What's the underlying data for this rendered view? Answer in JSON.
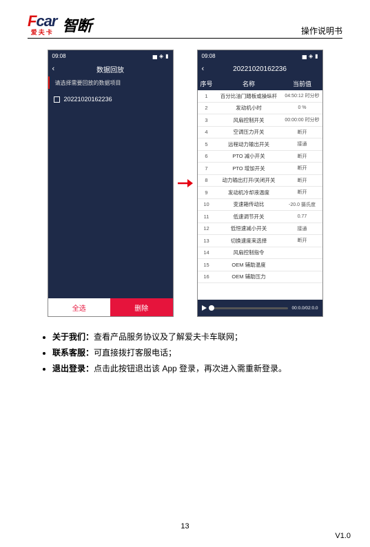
{
  "header": {
    "fcar_f": "F",
    "fcar_car": "car",
    "fcar_sub": "爱夫卡",
    "zd": "智断",
    "doc_title": "操作说明书"
  },
  "left_phone": {
    "time": "09:08",
    "title": "数据回放",
    "subtitle": "请选择需要回放的数据项目",
    "item1": "20221020162236",
    "btn_all": "全选",
    "btn_del": "删除"
  },
  "right_phone": {
    "time": "09:08",
    "title": "20221020162236",
    "head_idx": "序号",
    "head_name": "名称",
    "head_val": "当前值",
    "rows": [
      {
        "i": "1",
        "n": "百分比油门踏板或操纵杆",
        "v": "04:50:12 时分秒"
      },
      {
        "i": "2",
        "n": "发动机小时",
        "v": "0 %"
      },
      {
        "i": "3",
        "n": "风扇控制开关",
        "v": "00:00:00 时分秒"
      },
      {
        "i": "4",
        "n": "空调压力开关",
        "v": "断开"
      },
      {
        "i": "5",
        "n": "远程动力输出开关",
        "v": "接通"
      },
      {
        "i": "6",
        "n": "PTO 减小开关",
        "v": "断开"
      },
      {
        "i": "7",
        "n": "PTO 增加开关",
        "v": "断开"
      },
      {
        "i": "8",
        "n": "动力输出打开/关闭开关",
        "v": "断开"
      },
      {
        "i": "9",
        "n": "发动机冷却液温度",
        "v": "断开"
      },
      {
        "i": "10",
        "n": "变速箱传动比",
        "v": "-20.0 摄氏度"
      },
      {
        "i": "11",
        "n": "低速调节开关",
        "v": "0.77"
      },
      {
        "i": "12",
        "n": "低恒速减小开关",
        "v": "接通"
      },
      {
        "i": "13",
        "n": "切换速度来选择",
        "v": "断开"
      },
      {
        "i": "14",
        "n": "风扇控制指令",
        "v": ""
      },
      {
        "i": "15",
        "n": "OEM 辅助温度",
        "v": ""
      },
      {
        "i": "16",
        "n": "OEM 辅助压力",
        "v": ""
      }
    ],
    "player_time": "00:0.0/02:0.0"
  },
  "bullets": {
    "b1_label": "关于我们：",
    "b1_text": "查看产品服务协议及了解爱夫卡车联网；",
    "b2_label": "联系客服：",
    "b2_text": "可直接拨打客服电话；",
    "b3_label": "退出登录：",
    "b3_text": "点击此按钮退出该 App 登录，再次进入需重新登录。"
  },
  "footer": {
    "page": "13",
    "version": "V1.0"
  }
}
